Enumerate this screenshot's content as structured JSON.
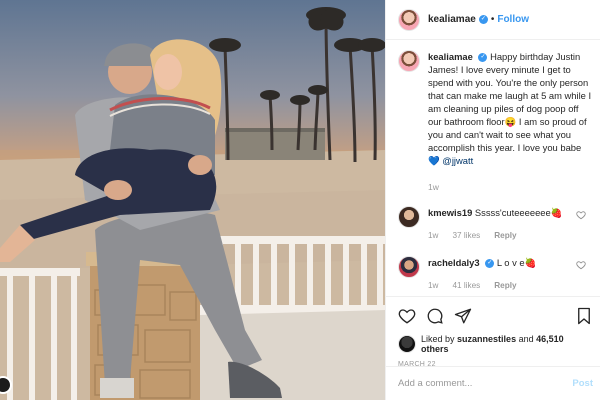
{
  "post": {
    "username": "kealiamae",
    "follow_label": "Follow",
    "dot": "•",
    "caption_text": "Happy birthday Justin James! I love every minute I get to spend with you. You're the only person that can make me laugh at 5 am while I am cleaning up piles of dog poop off our bathroom floor😝 I am so proud of you and can't wait to see what you accomplish this year. I love you babe💙",
    "caption_mention": "@jjwatt",
    "caption_time": "1w"
  },
  "comments": [
    {
      "username": "kmewis19",
      "text": "Sssss'cuteeeeeee🍓",
      "time": "1w",
      "likes": "37 likes",
      "reply": "Reply"
    },
    {
      "username": "racheldaly3",
      "text": "L o v e🍓",
      "time": "1w",
      "likes": "41 likes",
      "reply": "Reply"
    }
  ],
  "likes": {
    "prefix": "Liked by",
    "user": "suzannestiles",
    "middle": "and",
    "count": "46,510 others"
  },
  "date": "MARCH 22",
  "add_comment": {
    "placeholder": "Add a comment...",
    "post_label": "Post"
  },
  "colors": {
    "accent": "#3897f0",
    "post_disabled": "#b2dffc",
    "muted": "#999999"
  },
  "icons": [
    "verified-icon",
    "heart-icon",
    "comment-icon",
    "share-icon",
    "bookmark-icon"
  ]
}
